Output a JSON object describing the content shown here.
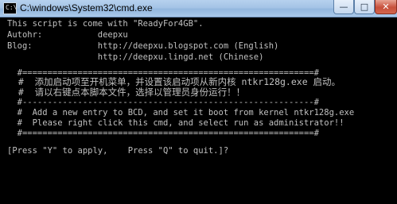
{
  "window": {
    "title": "C:\\windows\\System32\\cmd.exe",
    "icon": "cmd-icon",
    "controls": {
      "minimize": "—",
      "maximize": "□",
      "close": "✕"
    }
  },
  "console": {
    "lines": [
      "This script is come with \"ReadyFor4GB\".",
      "Autohr:           deepxu",
      "Blog:             http://deepxu.blogspot.com (English)",
      "                  http://deepxu.lingd.net (Chinese)",
      "",
      "  #==========================================================#",
      "  #  添加启动项至开机菜单，并设置该启动项从新内核 ntkr128g.exe 启动。",
      "  #  请以右键点本脚本文件，选择以管理员身份运行！！",
      "  #----------------------------------------------------------#",
      "  #  Add a new entry to BCD, and set it boot from kernel ntkr128g.exe",
      "  #  Please right click this cmd, and select run as administrator!!",
      "  #==========================================================#",
      "",
      "[Press \"Y\" to apply,    Press \"Q\" to quit.]?"
    ]
  },
  "colors": {
    "console_bg": "#000000",
    "console_fg": "#c0c0c0"
  }
}
